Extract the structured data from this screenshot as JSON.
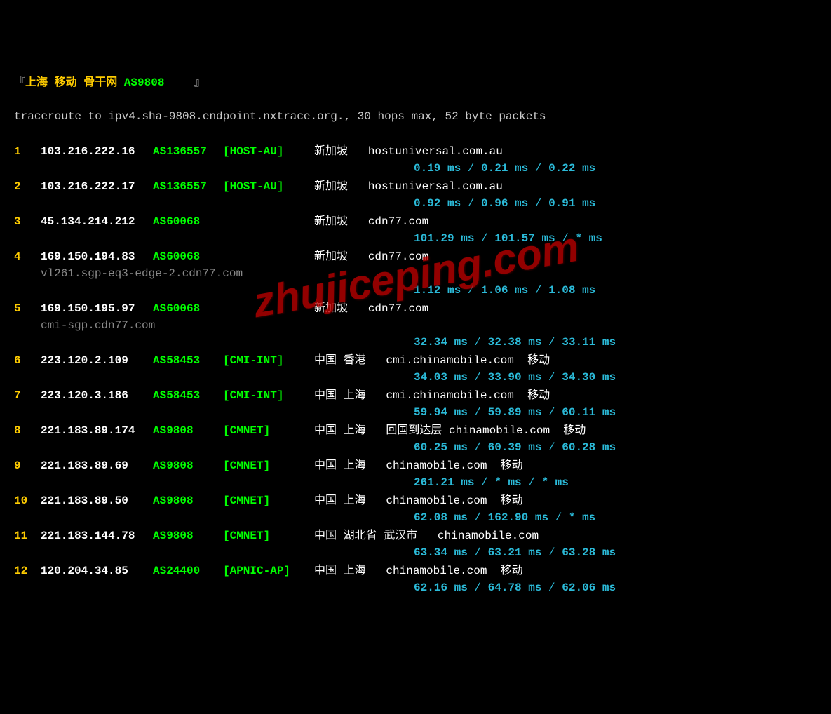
{
  "header_prefix": "『",
  "header_title": "上海 移动 骨干网 ",
  "header_asn": "AS9808 ",
  "header_suffix": "』",
  "subheader": "traceroute to ipv4.sha-9808.endpoint.nxtrace.org., 30 hops max, 52 byte packets",
  "watermark": "zhujiceping.com",
  "hops": [
    {
      "n": "1",
      "ip": "103.216.222.16",
      "asn": "AS136557",
      "tag": "[HOST-AU]",
      "loc": "新加坡",
      "dom": "hostuniversal.com.au",
      "car": "",
      "host": "",
      "lat": [
        "0.19 ms",
        "0.21 ms",
        "0.22 ms"
      ]
    },
    {
      "n": "2",
      "ip": "103.216.222.17",
      "asn": "AS136557",
      "tag": "[HOST-AU]",
      "loc": "新加坡",
      "dom": "hostuniversal.com.au",
      "car": "",
      "host": "",
      "lat": [
        "0.92 ms",
        "0.96 ms",
        "0.91 ms"
      ]
    },
    {
      "n": "3",
      "ip": "45.134.214.212",
      "asn": "AS60068",
      "tag": "",
      "loc": "新加坡",
      "dom": "cdn77.com",
      "car": "",
      "host": "",
      "lat": [
        "101.29 ms",
        "101.57 ms",
        "* ms"
      ]
    },
    {
      "n": "4",
      "ip": "169.150.194.83",
      "asn": "AS60068",
      "tag": "",
      "loc": "新加坡",
      "dom": "cdn77.com",
      "car": "",
      "host": "vl261.sgp-eq3-edge-2.cdn77.com",
      "lat": [
        "1.12 ms",
        "1.06 ms",
        "1.08 ms"
      ]
    },
    {
      "n": "5",
      "ip": "169.150.195.97",
      "asn": "AS60068",
      "tag": "",
      "loc": "新加坡",
      "dom": "cdn77.com",
      "car": "",
      "host": "cmi-sgp.cdn77.com",
      "lat": [
        "32.34 ms",
        "32.38 ms",
        "33.11 ms"
      ]
    },
    {
      "n": "6",
      "ip": "223.120.2.109",
      "asn": "AS58453",
      "tag": "[CMI-INT]",
      "loc": "中国 香港",
      "dom": "cmi.chinamobile.com",
      "car": "移动",
      "host": "",
      "lat": [
        "34.03 ms",
        "33.90 ms",
        "34.30 ms"
      ]
    },
    {
      "n": "7",
      "ip": "223.120.3.186",
      "asn": "AS58453",
      "tag": "[CMI-INT]",
      "loc": "中国 上海",
      "dom": "cmi.chinamobile.com",
      "car": "移动",
      "host": "",
      "lat": [
        "59.94 ms",
        "59.89 ms",
        "60.11 ms"
      ]
    },
    {
      "n": "8",
      "ip": "221.183.89.174",
      "asn": "AS9808",
      "tag": "[CMNET]",
      "loc": "中国 上海",
      "dom": "回国到达层 chinamobile.com",
      "car": "移动",
      "host": "",
      "lat": [
        "60.25 ms",
        "60.39 ms",
        "60.28 ms"
      ]
    },
    {
      "n": "9",
      "ip": "221.183.89.69",
      "asn": "AS9808",
      "tag": "[CMNET]",
      "loc": "中国 上海",
      "dom": "chinamobile.com",
      "car": "移动",
      "host": "",
      "lat": [
        "261.21 ms",
        "* ms",
        "* ms"
      ]
    },
    {
      "n": "10",
      "ip": "221.183.89.50",
      "asn": "AS9808",
      "tag": "[CMNET]",
      "loc": "中国 上海",
      "dom": "chinamobile.com",
      "car": "移动",
      "host": "",
      "lat": [
        "62.08 ms",
        "162.90 ms",
        "* ms"
      ]
    },
    {
      "n": "11",
      "ip": "221.183.144.78",
      "asn": "AS9808",
      "tag": "[CMNET]",
      "loc": "中国 湖北省 武汉市",
      "dom": "chinamobile.com",
      "car": "",
      "host": "",
      "lat": [
        "63.34 ms",
        "63.21 ms",
        "63.28 ms"
      ]
    },
    {
      "n": "12",
      "ip": "120.204.34.85",
      "asn": "AS24400",
      "tag": "[APNIC-AP]",
      "loc": "中国 上海",
      "dom": "chinamobile.com",
      "car": "移动",
      "host": "",
      "lat": [
        "62.16 ms",
        "64.78 ms",
        "62.06 ms"
      ]
    }
  ]
}
